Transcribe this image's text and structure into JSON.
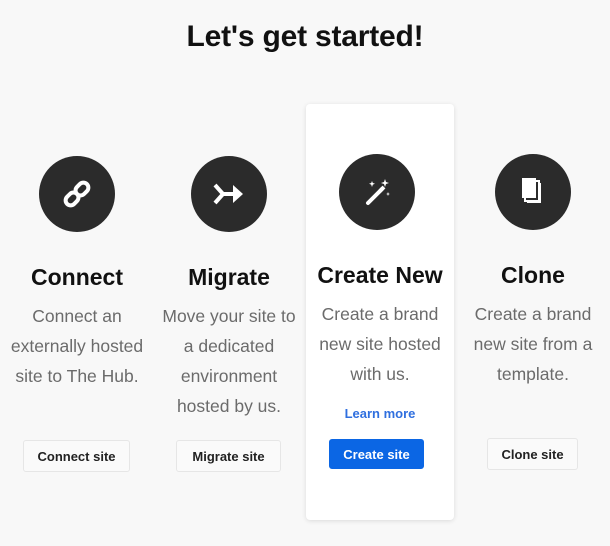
{
  "page": {
    "title": "Let's get started!"
  },
  "cards": {
    "connect": {
      "icon": "link-icon",
      "title": "Connect",
      "description": [
        "Connect an",
        "externally hosted",
        "site to The Hub."
      ],
      "button_label": "Connect site"
    },
    "migrate": {
      "icon": "migrate-arrow-icon",
      "title": "Migrate",
      "description": [
        "Move your site to",
        "a dedicated",
        "environment",
        "hosted by us."
      ],
      "button_label": "Migrate site"
    },
    "create": {
      "icon": "magic-wand-icon",
      "title": "Create New",
      "description": [
        "Create a brand",
        "new site hosted",
        "with us."
      ],
      "link_label": "Learn more",
      "button_label": "Create site"
    },
    "clone": {
      "icon": "copy-pages-icon",
      "title": "Clone",
      "description": [
        "Create a brand",
        "new site from a",
        "template."
      ],
      "button_label": "Clone site"
    }
  },
  "colors": {
    "icon_bg": "#2b2b2b",
    "primary": "#0b66e4",
    "link": "#2f6fdf",
    "text_muted": "#6b6b6b"
  }
}
